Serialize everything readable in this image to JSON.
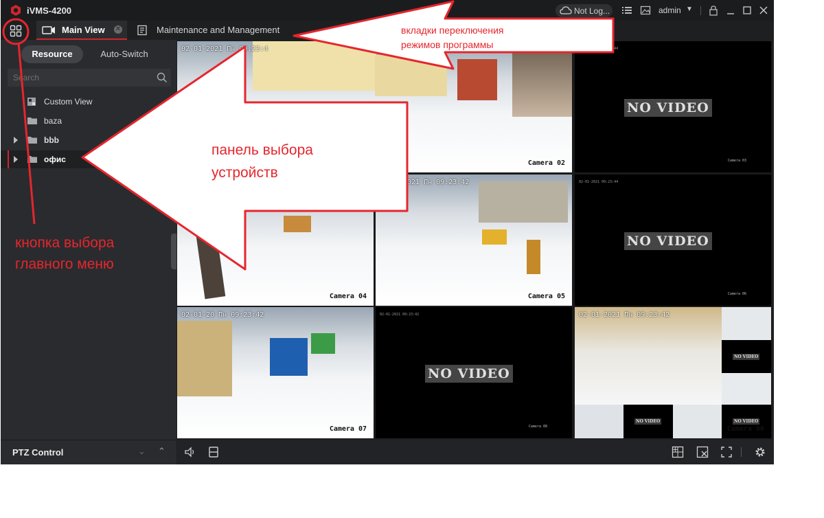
{
  "app": {
    "title": "iVMS-4200"
  },
  "titlebar": {
    "cloud_status": "Not Log...",
    "user": "admin"
  },
  "tabs": {
    "main_view": "Main View",
    "maintenance": "Maintenance and Management"
  },
  "left_panel": {
    "segment": {
      "resource": "Resource",
      "auto_switch": "Auto-Switch"
    },
    "search_placeholder": "Search",
    "tree": [
      {
        "label": "Custom View",
        "icon": "custom-view-icon"
      },
      {
        "label": "baza",
        "icon": "folder-icon"
      },
      {
        "label": "bbb",
        "icon": "folder-icon",
        "expandable": true
      },
      {
        "label": "офис",
        "icon": "folder-icon",
        "expandable": true,
        "selected": true
      }
    ],
    "ptz_label": "PTZ Control"
  },
  "cells": [
    {
      "timestamp": "02-01-2021 Пн 09:23:4",
      "camera": "Camera 02",
      "status": "video"
    },
    {
      "timestamp": "",
      "camera": "",
      "status": "no-video",
      "no_video_text": "NO VIDEO"
    },
    {
      "timestamp": "",
      "camera": "Camera 04",
      "status": "video"
    },
    {
      "timestamp": "2021 Пн 09:23:42",
      "camera": "Camera 05",
      "status": "video"
    },
    {
      "timestamp": "",
      "camera": "",
      "status": "no-video",
      "no_video_text": "NO VIDEO"
    },
    {
      "timestamp": "02-01-20 Пн 09:23:42",
      "camera": "Camera 07",
      "status": "video"
    },
    {
      "timestamp": "",
      "camera": "",
      "status": "no-video",
      "no_video_text": "NO VIDEO"
    },
    {
      "timestamp": "02-01-2021 Пн 09:23:42",
      "camera": "Camera 00",
      "status": "video"
    }
  ],
  "annotations": {
    "tabs_note_line1": "вкладки переключения",
    "tabs_note_line2": "режимов программы",
    "panel_note_line1": "панель выбора",
    "panel_note_line2": "устройств",
    "menu_note_line1": "кнопка выбора",
    "menu_note_line2": "главного меню",
    "color": "#e5262d"
  }
}
